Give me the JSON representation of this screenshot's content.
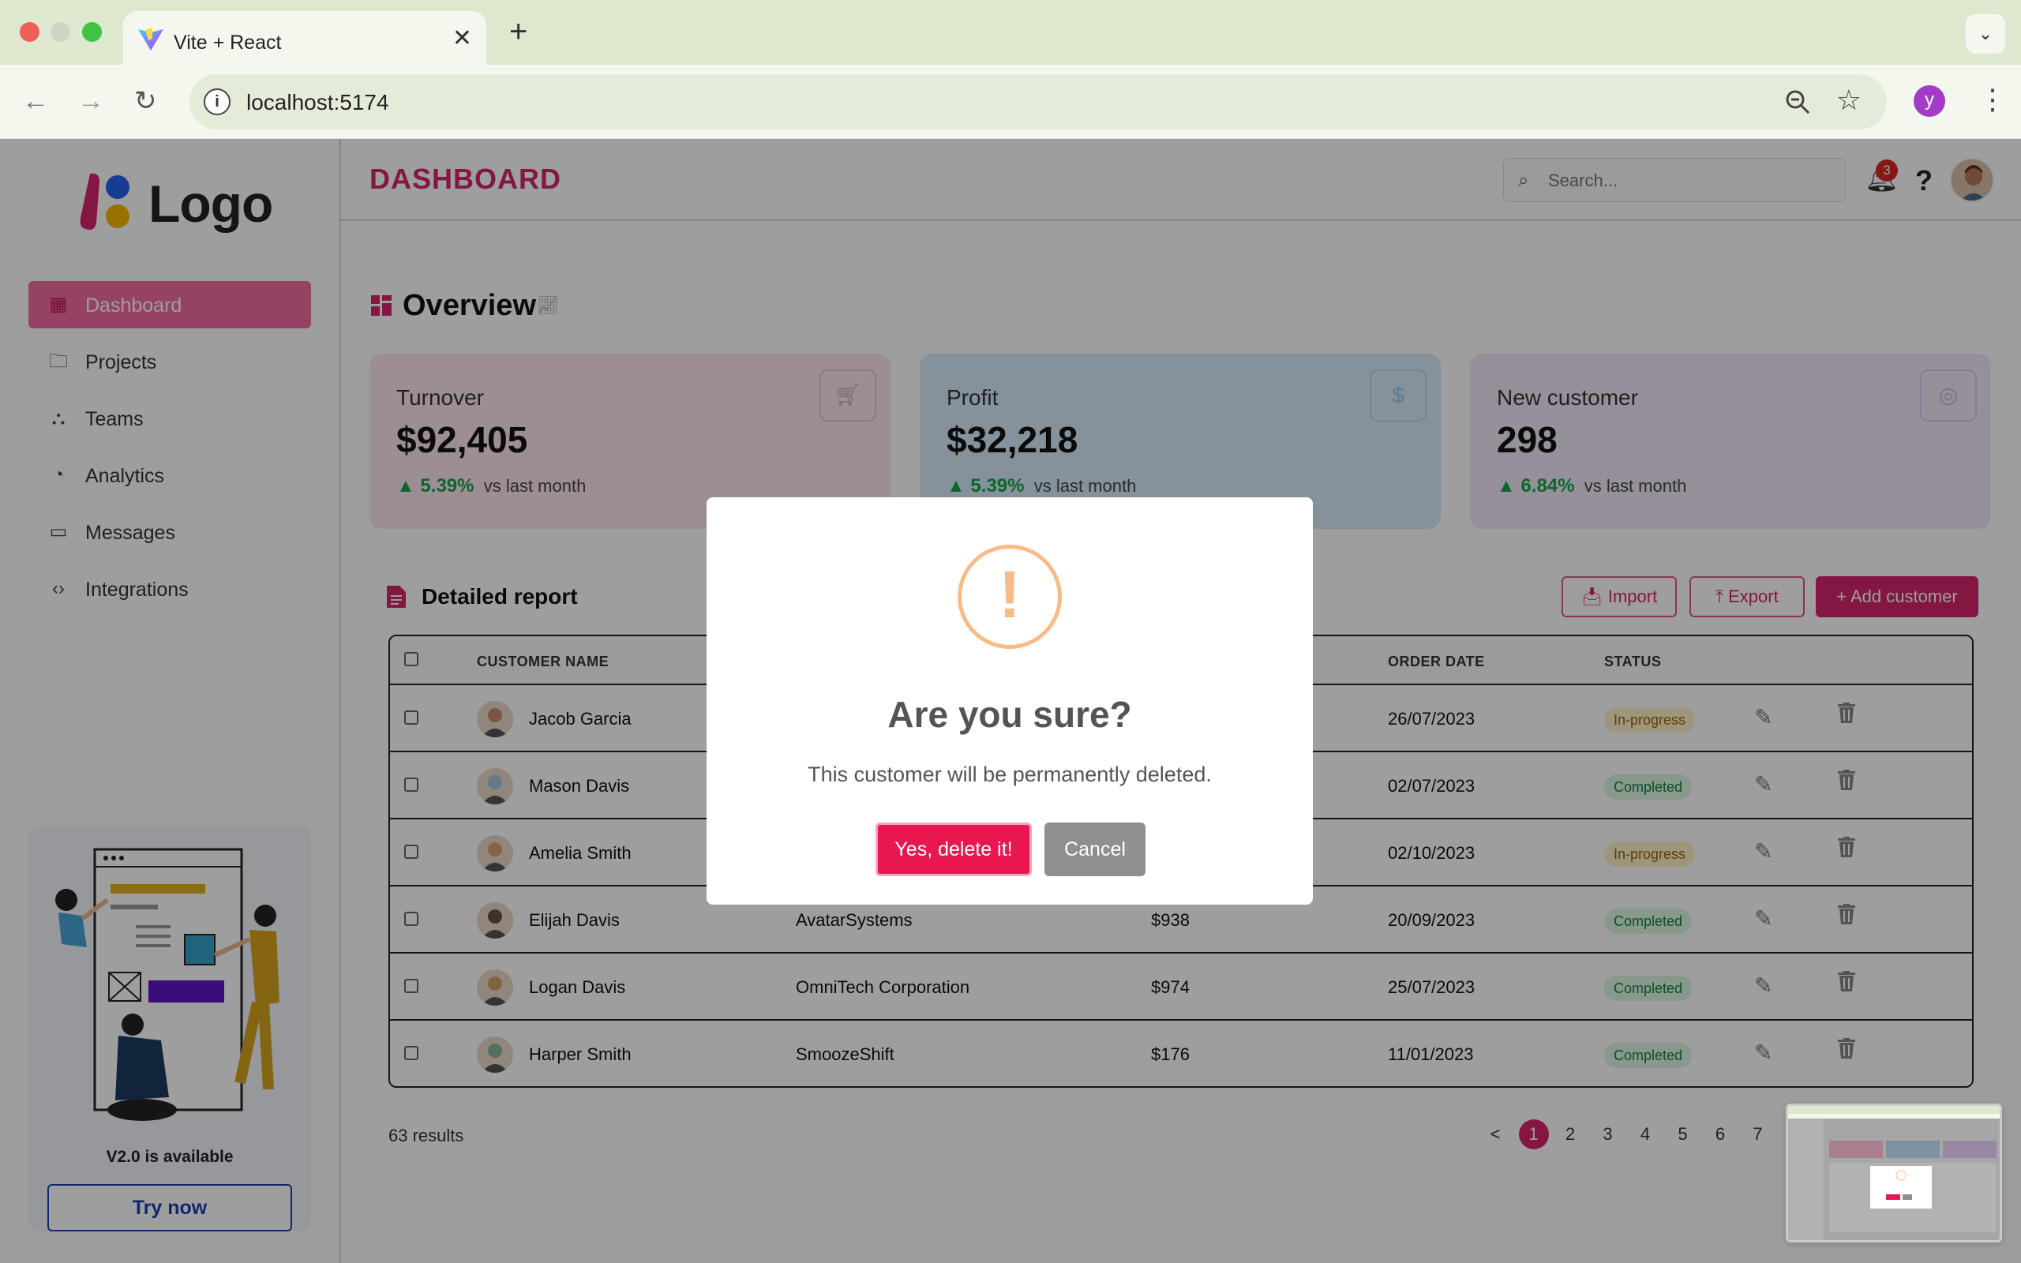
{
  "browser": {
    "tab_title": "Vite + React",
    "tab_close": "✕",
    "new_tab": "+",
    "tab_menu": "⌄",
    "url": "localhost:5174",
    "profile_initial": "y"
  },
  "app": {
    "logo_text": "Logo",
    "page_title": "DASHBOARD",
    "search_placeholder": "Search...",
    "notification_count": "3",
    "help": "?"
  },
  "sidebar": {
    "items": [
      {
        "label": "Dashboard",
        "icon": "grid-icon",
        "active": true
      },
      {
        "label": "Projects",
        "icon": "folder-icon"
      },
      {
        "label": "Teams",
        "icon": "teams-icon"
      },
      {
        "label": "Analytics",
        "icon": "pie-chart-icon"
      },
      {
        "label": "Messages",
        "icon": "message-icon"
      },
      {
        "label": "Integrations",
        "icon": "code-icon"
      }
    ],
    "promo_text": "V2.0 is available",
    "promo_button": "Try now"
  },
  "overview": {
    "title": "Overview",
    "cards": [
      {
        "label": "Turnover",
        "value": "$92,405",
        "trend": "5.39%",
        "trend_suffix": "vs last month",
        "icon": "cart-icon",
        "color": "#fde4ef"
      },
      {
        "label": "Profit",
        "value": "$32,218",
        "trend": "5.39%",
        "trend_suffix": "vs last month",
        "icon": "dollar-icon",
        "color": "#d7ecfb"
      },
      {
        "label": "New customer",
        "value": "298",
        "trend": "6.84%",
        "trend_suffix": "vs last month",
        "icon": "user-circle-icon",
        "color": "#f3e8fb"
      }
    ]
  },
  "report": {
    "title": "Detailed report",
    "import_label": "Import",
    "export_label": "Export",
    "add_label": "Add customer",
    "columns": [
      "CUSTOMER NAME",
      "ORDER DATE",
      "STATUS"
    ],
    "rows": [
      {
        "name": "Jacob Garcia",
        "company": "",
        "value": "",
        "date": "26/07/2023",
        "status": "In-progress"
      },
      {
        "name": "Mason Davis",
        "company": "",
        "value": "",
        "date": "02/07/2023",
        "status": "Completed"
      },
      {
        "name": "Amelia Smith",
        "company": "",
        "value": "",
        "date": "02/10/2023",
        "status": "In-progress"
      },
      {
        "name": "Elijah Davis",
        "company": "AvatarSystems",
        "value": "$938",
        "date": "20/09/2023",
        "status": "Completed"
      },
      {
        "name": "Logan Davis",
        "company": "OmniTech Corporation",
        "value": "$974",
        "date": "25/07/2023",
        "status": "Completed"
      },
      {
        "name": "Harper Smith",
        "company": "SmoozeShift",
        "value": "$176",
        "date": "11/01/2023",
        "status": "Completed"
      }
    ],
    "results_count": "63 results",
    "pages": [
      "<",
      "1",
      "2",
      "3",
      "4",
      "5",
      "6",
      "7"
    ],
    "current_page": "1"
  },
  "modal": {
    "icon_mark": "!",
    "title": "Are you sure?",
    "text": "This customer will be permanently deleted.",
    "confirm_label": "Yes, delete it!",
    "cancel_label": "Cancel"
  },
  "colors": {
    "brand": "#d6246e",
    "active_nav": "#f06ba3",
    "confirm": "#e8174f",
    "warning": "#f8bb86"
  }
}
